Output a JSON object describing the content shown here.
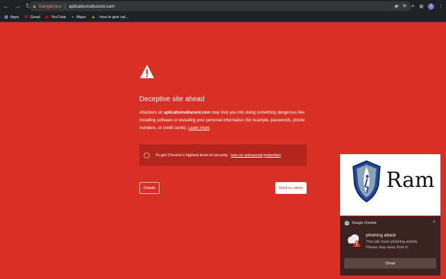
{
  "browser": {
    "security_label": "Dangerous",
    "url": "aplicationsdiscord.com",
    "profile_initial": "J"
  },
  "bookmarks": [
    {
      "label": "Apps",
      "icon": "apps-grid-icon"
    },
    {
      "label": "Gmail",
      "icon": "gmail-icon"
    },
    {
      "label": "YouTube",
      "icon": "youtube-icon"
    },
    {
      "label": "Maps",
      "icon": "maps-icon"
    },
    {
      "label": "- how to give cal...",
      "icon": "bookmark-favicon-icon"
    }
  ],
  "interstitial": {
    "heading": "Deceptive site ahead",
    "desc_pre": "Attackers on ",
    "desc_domain": "aplicationsdiscord.com",
    "desc_post": " may trick you into doing something dangerous like installing software or revealing your personal information (for example, passwords, phone numbers, or credit cards).",
    "learn_more": "Learn more",
    "enhanced_text": "To get Chrome's highest level of security,",
    "enhanced_link": "turn on enhanced protection",
    "details_label": "Details",
    "back_label": "Back to safety",
    "background_color": "#d93025"
  },
  "logo_card": {
    "text": "Ram"
  },
  "notification": {
    "app_name": "Google Chrome",
    "title": "phishing attack",
    "body_line1": "This site have phishing activity",
    "body_line2": "Please stay away from it.",
    "close_label": "Close"
  }
}
